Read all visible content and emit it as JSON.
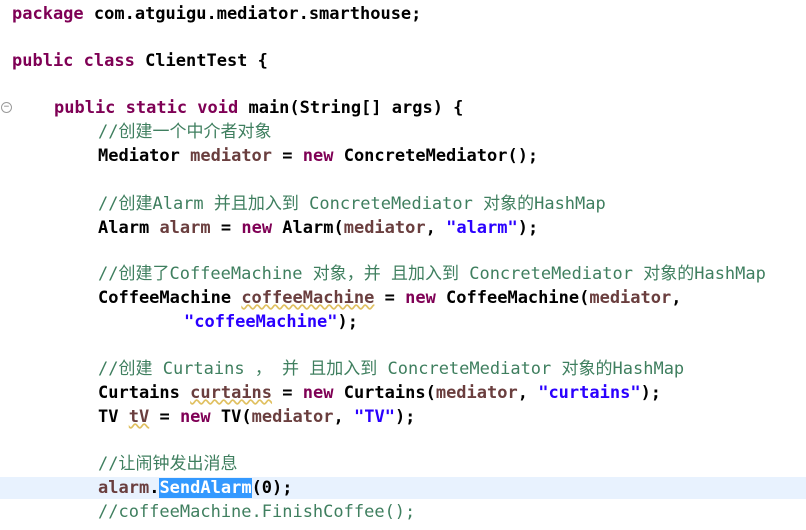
{
  "editor": {
    "lines": {
      "pkg_kw": "package",
      "pkg_name": " com.atguigu.mediator.smarthouse;",
      "class_kw": "public class",
      "class_name": " ClientTest {",
      "main_kw": "public static void",
      "main_rest": " main(String[] args) {",
      "c1": "//创建一个中介者对象",
      "l1_type": "Mediator",
      "l1_var": "mediator",
      "l1_eq": " = ",
      "l1_new": "new",
      "l1_rest": " ConcreteMediator();",
      "c2": "//创建Alarm 并且加入到 ConcreteMediator 对象的HashMap",
      "l2_type": "Alarm",
      "l2_var": "alarm",
      "l2_eq": " = ",
      "l2_new": "new",
      "l2_mid": " Alarm(",
      "l2_arg": "mediator",
      "l2_comma": ", ",
      "l2_str": "\"alarm\"",
      "l2_end": ");",
      "c3": "//创建了CoffeeMachine 对象，并 且加入到 ConcreteMediator 对象的HashMap",
      "l3_type": "CoffeeMachine",
      "l3_var": "coffeeMachine",
      "l3_eq": " = ",
      "l3_new": "new",
      "l3_mid": " CoffeeMachine(",
      "l3_arg": "mediator",
      "l3_end": ",",
      "l3b_str": "\"coffeeMachine\"",
      "l3b_end": ");",
      "c4": "//创建 Curtains ， 并 且加入到 ConcreteMediator 对象的HashMap",
      "l4_type": "Curtains",
      "l4_var": "curtains",
      "l4_eq": " = ",
      "l4_new": "new",
      "l4_mid": " Curtains(",
      "l4_arg": "mediator",
      "l4_comma": ", ",
      "l4_str": "\"curtains\"",
      "l4_end": ");",
      "l5_type": "TV",
      "l5_var": "tV",
      "l5_eq": " = ",
      "l5_new": "new",
      "l5_mid": " TV(",
      "l5_arg": "mediator",
      "l5_comma": ", ",
      "l5_str": "\"TV\"",
      "l5_end": ");",
      "c5": "//让闹钟发出消息",
      "l6_var": "alarm",
      "l6_dot": ".",
      "l6_sel": "SendAlarm",
      "l6_end": "(0);",
      "c6": "//coffeeMachine.FinishCoffee();"
    }
  }
}
